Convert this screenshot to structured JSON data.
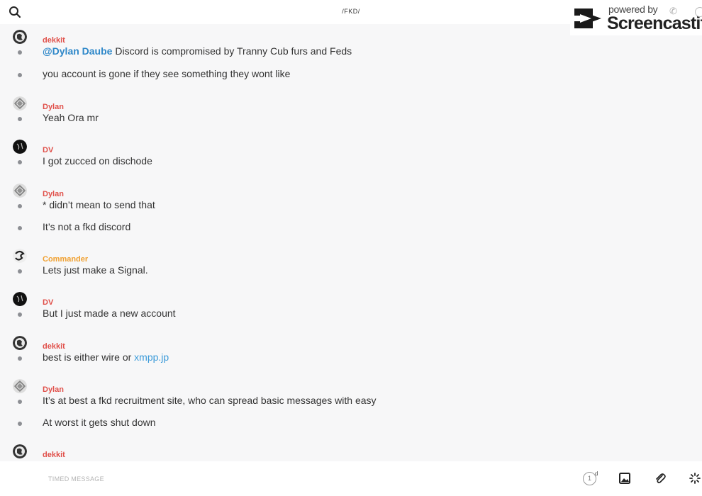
{
  "header": {
    "title": "/FKD/"
  },
  "watermark": {
    "line1": "powered by",
    "line2": "Screencastify"
  },
  "colors": {
    "red_author": "#e0504a",
    "orange_author": "#f0a030",
    "mention": "#2f88c9",
    "link": "#3a9ad9"
  },
  "messages": [
    {
      "author": "dekkit",
      "avatar": "globe",
      "author_color": "#e0504a",
      "lines": [
        {
          "mention": "@Dylan Daube",
          "text": " Discord is compromised by Tranny Cub furs and Feds"
        },
        {
          "text": "you account is gone if they see something they wont like"
        }
      ]
    },
    {
      "author": "Dylan",
      "avatar": "pattern",
      "author_color": "#e0504a",
      "lines": [
        {
          "text": "Yeah Ora mr"
        }
      ]
    },
    {
      "author": "DV",
      "avatar": "dark",
      "author_color": "#e0504a",
      "lines": [
        {
          "text": "I got zucced on dischode"
        }
      ]
    },
    {
      "author": "Dylan",
      "avatar": "pattern",
      "author_color": "#e0504a",
      "lines": [
        {
          "text": "* didn’t mean to send that"
        },
        {
          "text": "It’s not a fkd discord"
        }
      ]
    },
    {
      "author": "Commander",
      "avatar": "serpent",
      "author_color": "#f0a030",
      "lines": [
        {
          "text": "Lets just make a Signal."
        }
      ]
    },
    {
      "author": "DV",
      "avatar": "dark",
      "author_color": "#e0504a",
      "lines": [
        {
          "text": "But I just made a new account"
        }
      ]
    },
    {
      "author": "dekkit",
      "avatar": "globe",
      "author_color": "#e0504a",
      "lines": [
        {
          "text": "best is either wire or ",
          "link": "xmpp.jp"
        }
      ]
    },
    {
      "author": "Dylan",
      "avatar": "pattern",
      "author_color": "#e0504a",
      "lines": [
        {
          "text": "It’s at best a fkd recruitment site, who can spread basic messages with easy"
        },
        {
          "text": "At worst it gets shut down"
        }
      ]
    },
    {
      "author": "dekkit",
      "avatar": "globe",
      "author_color": "#e0504a",
      "lines": []
    }
  ],
  "composer": {
    "placeholder": "TIMED MESSAGE",
    "timer_value": "1",
    "timer_unit": "d",
    "icons": [
      "image-icon",
      "paperclip-icon",
      "loading-spinner-icon"
    ]
  }
}
